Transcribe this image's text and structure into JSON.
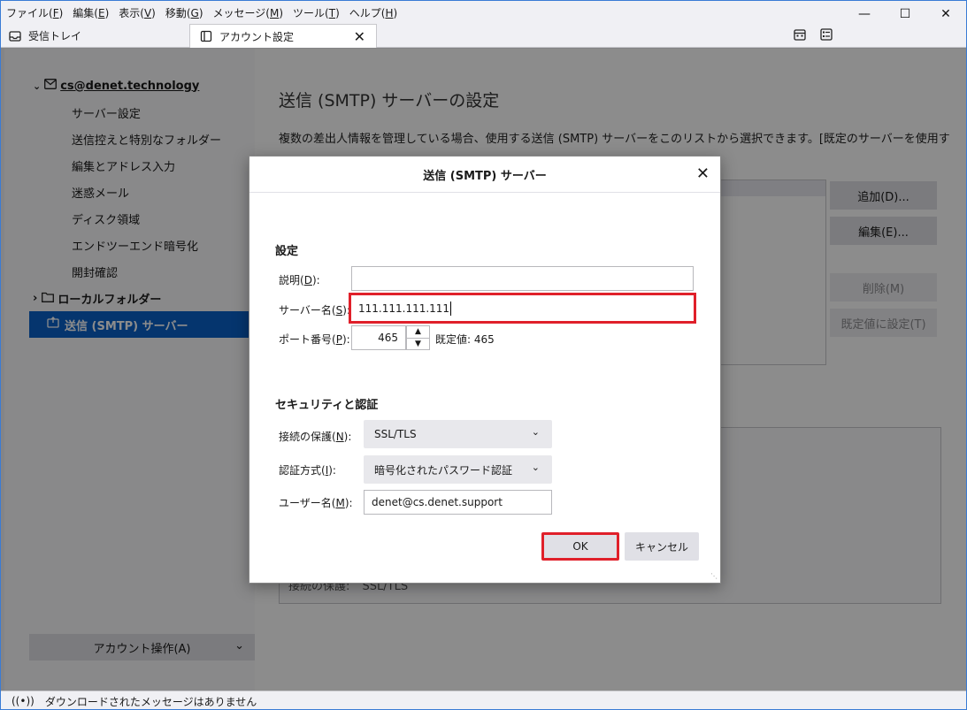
{
  "menubar": {
    "items": [
      {
        "label": "ファイル(",
        "key": "F",
        "tail": ")"
      },
      {
        "label": "編集(",
        "key": "E",
        "tail": ")"
      },
      {
        "label": "表示(",
        "key": "V",
        "tail": ")"
      },
      {
        "label": "移動(",
        "key": "G",
        "tail": ")"
      },
      {
        "label": "メッセージ(",
        "key": "M",
        "tail": ")"
      },
      {
        "label": "ツール(",
        "key": "T",
        "tail": ")"
      },
      {
        "label": "ヘルプ(",
        "key": "H",
        "tail": ")"
      }
    ]
  },
  "tabs": [
    {
      "label": "受信トレイ",
      "icon": "inbox-icon"
    },
    {
      "label": "アカウント設定",
      "icon": "account-settings-icon"
    }
  ],
  "sidebar": {
    "account_email": "cs@denet.technology",
    "items": [
      {
        "label": "サーバー設定"
      },
      {
        "label": "送信控えと特別なフォルダー"
      },
      {
        "label": "編集とアドレス入力"
      },
      {
        "label": "迷惑メール"
      },
      {
        "label": "ディスク領域"
      },
      {
        "label": "エンドツーエンド暗号化"
      },
      {
        "label": "開封確認"
      }
    ],
    "local_folders": "ローカルフォルダー",
    "smtp_item": "送信 (SMTP) サーバー",
    "account_actions": "アカウント操作(A)"
  },
  "content": {
    "title": "送信 (SMTP) サーバーの設定",
    "description": "複数の差出人情報を管理している場合、使用する送信 (SMTP) サーバーをこのリストから選択できます。[既定のサーバーを使用する",
    "buttons": {
      "add": "追加(D)...",
      "edit": "編集(E)...",
      "delete": "削除(M)",
      "set_default": "既定値に設定(T)"
    },
    "details_security_label": "接続の保護:",
    "details_security_value": "SSL/TLS"
  },
  "dialog": {
    "title": "送信 (SMTP) サーバー",
    "settings_heading": "設定",
    "description_label": {
      "label": "説明(",
      "key": "D",
      "tail": "):"
    },
    "description_value": "",
    "server_label": {
      "label": "サーバー名(",
      "key": "S",
      "tail": "):"
    },
    "server_value": "111.111.111.111",
    "port_label": {
      "label": "ポート番号(",
      "key": "P",
      "tail": "):"
    },
    "port_value": "465",
    "default_port": "既定値:  465",
    "security_heading": "セキュリティと認証",
    "conn_security_label": {
      "label": "接続の保護(",
      "key": "N",
      "tail": "):"
    },
    "conn_security_value": "SSL/TLS",
    "auth_label": {
      "label": "認証方式(",
      "key": "I",
      "tail": "):"
    },
    "auth_value": "暗号化されたパスワード認証",
    "username_label": {
      "label": "ユーザー名(",
      "key": "M",
      "tail": "):"
    },
    "username_value": "denet@cs.denet.support",
    "ok_label": "OK",
    "cancel_label": "キャンセル"
  },
  "statusbar": {
    "text": "ダウンロードされたメッセージはありません"
  },
  "colors": {
    "accent": "#0a61c9",
    "highlight_box": "#e0202a"
  }
}
